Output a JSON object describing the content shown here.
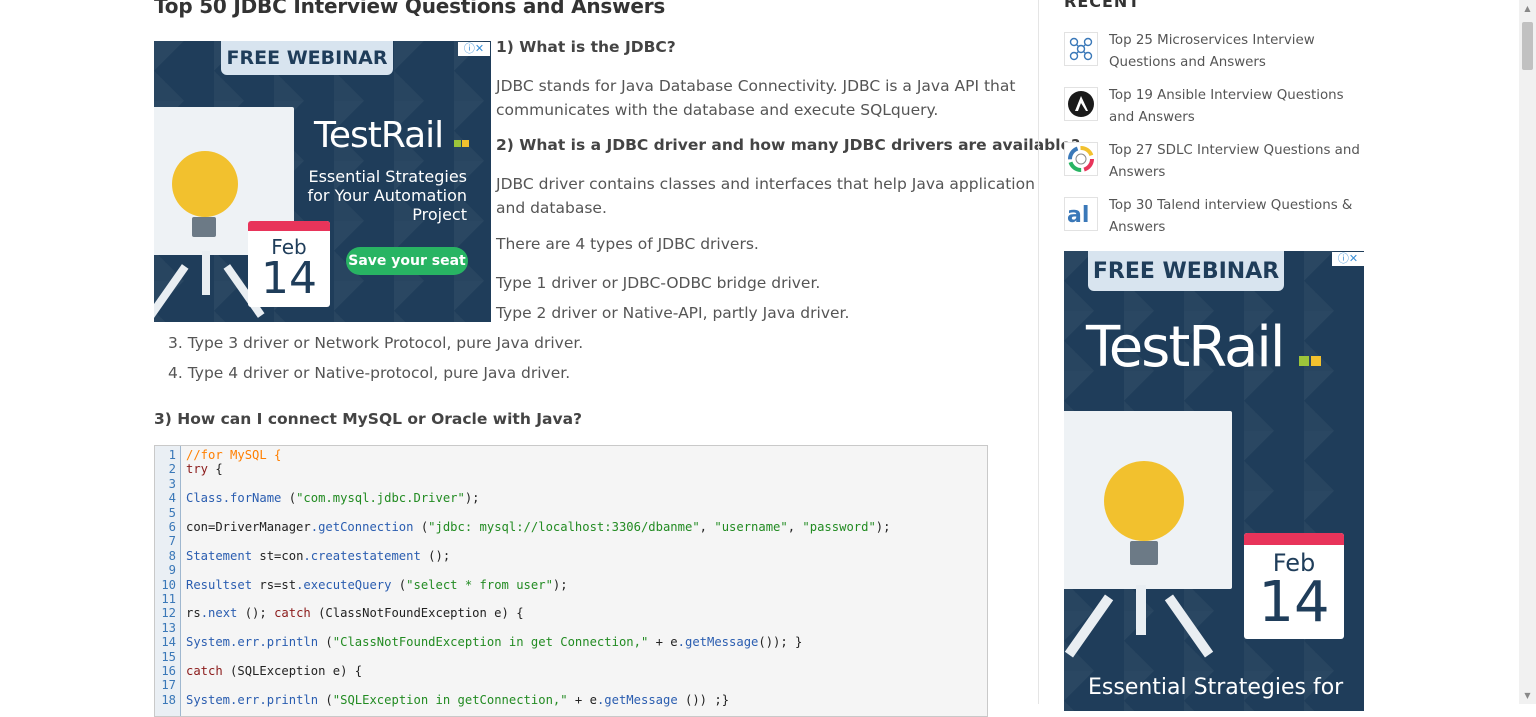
{
  "article": {
    "title": "Top 50 JDBC Interview Questions and Answers",
    "q1": "1) What is the JDBC?",
    "a1_line1": "JDBC stands for Java Database Connectivity. JDBC is a Java API that",
    "a1_line2": "communicates with the database and execute SQLquery.",
    "q2": "2) What is a JDBC driver and how many JDBC drivers are available?",
    "a2_line1": "JDBC driver contains classes and interfaces that help Java application",
    "a2_line2": "and database.",
    "a2_types_intro": "There are 4 types of JDBC drivers.",
    "driver_types": [
      "Type 1 driver or JDBC-ODBC bridge driver.",
      "Type 2 driver or Native-API, partly Java driver.",
      "3. Type 3 driver or Network Protocol, pure Java driver.",
      "4. Type 4 driver or Native-protocol, pure Java driver."
    ],
    "q3": "3) How can I connect MySQL or Oracle with Java?"
  },
  "code": {
    "line_numbers": [
      "1",
      "2",
      "3",
      "4",
      "5",
      "6",
      "7",
      "8",
      "9",
      "10",
      "11",
      "12",
      "13",
      "14",
      "15",
      "16",
      "17",
      "18"
    ],
    "lines": [
      "//for MySQL {",
      "try {",
      "",
      "Class.forName (\"com.mysql.jdbc.Driver\");",
      "",
      "con=DriverManager.getConnection (\"jdbc: mysql://localhost:3306/dbanme\", \"username\", \"password\");",
      "",
      "Statement st=con.createstatement ();",
      "",
      "Resultset rs=st.executeQuery (\"select * from user\");",
      "",
      "rs.next (); catch (ClassNotFoundException e) {",
      "",
      "System.err.println (\"ClassNotFoundException in get Connection,\" + e.getMessage()); }",
      "",
      "catch (SQLException e) {",
      "",
      "System.err.println (\"SQLException in getConnection,\" + e.getMessage ()) ;}"
    ]
  },
  "ad_inline": {
    "banner": "FREE WEBINAR",
    "brand": "TestRail",
    "tagline": [
      "Essential Strategies",
      "for Your Automation",
      "Project"
    ],
    "month": "Feb",
    "day": "14",
    "cta": "Save your seat",
    "adchoice": "ⓘ✕"
  },
  "sidebar": {
    "title": "RECENT",
    "items": [
      {
        "label": "Top 25 Microservices Interview Questions and Answers",
        "icon": "microservices-icon"
      },
      {
        "label": "Top 19 Ansible Interview Questions and Answers",
        "icon": "ansible-icon"
      },
      {
        "label": "Top 27 SDLC Interview Questions and Answers",
        "icon": "sdlc-icon"
      },
      {
        "label": "Top 30 Talend interview Questions & Answers",
        "icon": "talend-icon"
      }
    ],
    "ad": {
      "banner": "FREE WEBINAR",
      "brand": "TestRail",
      "month": "Feb",
      "day": "14",
      "tagline": "Essential Strategies for",
      "adchoice": "ⓘ✕"
    }
  },
  "colors": {
    "ad_bg": "#1f3d5a",
    "cta_green": "#28b463",
    "calendar_red": "#e8345a",
    "link_blue": "#3a78b8"
  }
}
